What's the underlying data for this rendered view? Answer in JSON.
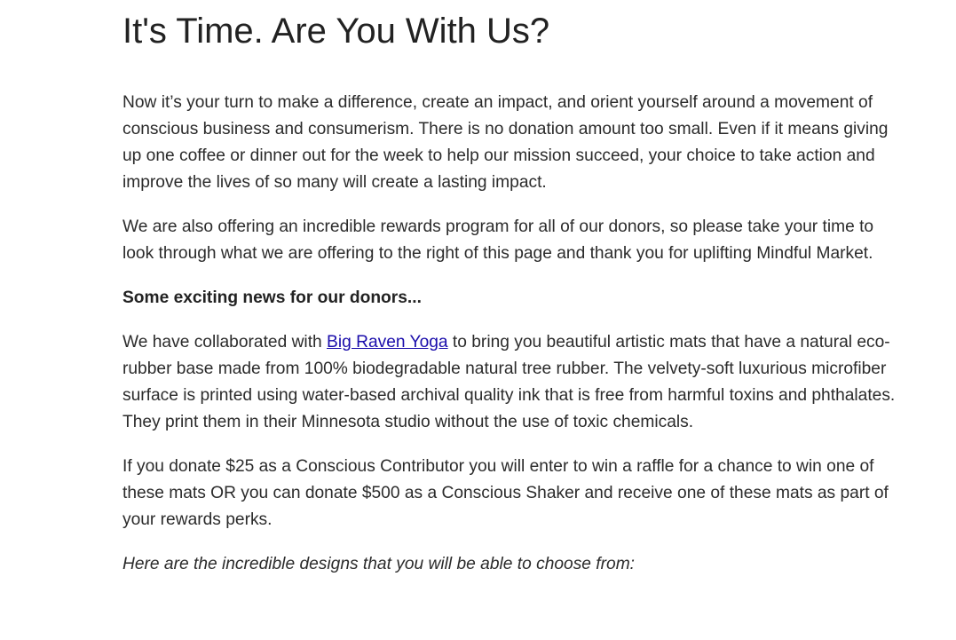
{
  "title": "It's Time. Are You With Us?",
  "paragraphs": {
    "intro": "Now it’s your turn to make a difference, create an impact, and orient yourself around a movement of conscious business and consumerism. There is no donation amount too small. Even if it means giving up one coffee or dinner out for the week to help our mission succeed, your choice to take action and improve the lives of so many will create a lasting impact.",
    "rewards": "We are also offering an incredible rewards program for all of our donors, so please take your time to look through what we are offering to the right of this page and thank you for uplifting Mindful Market.",
    "news_heading": "Some exciting news for our donors...",
    "collab_before_link": "We have collaborated with ",
    "collab_link": "Big Raven Yoga",
    "collab_after_link": " to bring you beautiful artistic mats that have a natural eco-rubber base made from 100% biodegradable natural tree rubber. The velvety-soft luxurious microfiber surface is printed using water-based archival quality ink that is free from harmful toxins and phthalates. They print them in their Minnesota studio without the use of toxic chemicals.",
    "donate": "If you donate $25 as a Conscious Contributor you will enter to win a raffle for a chance to win one of these mats OR you can donate $500 as a Conscious Shaker and receive one of these mats as part of your rewards perks.",
    "designs_caption": "Here are the incredible designs that you will be able to choose from:"
  },
  "colors": {
    "text": "#2b2b2b",
    "heading": "#222222",
    "link": "#1a0dab",
    "background": "#ffffff"
  }
}
